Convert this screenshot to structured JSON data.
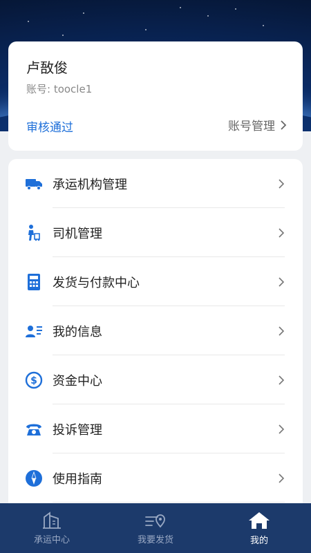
{
  "profile": {
    "name": "卢敔俊",
    "account": "账号: toocle1",
    "status": "审核通过",
    "manage_label": "账号管理"
  },
  "menu": {
    "items": [
      {
        "label": "承运机构管理",
        "icon": "truck-icon"
      },
      {
        "label": "司机管理",
        "icon": "driver-icon"
      },
      {
        "label": "发货与付款中心",
        "icon": "calculator-icon"
      },
      {
        "label": "我的信息",
        "icon": "id-card-icon"
      },
      {
        "label": "资金中心",
        "icon": "dollar-icon"
      },
      {
        "label": "投诉管理",
        "icon": "phone-icon"
      },
      {
        "label": "使用指南",
        "icon": "compass-icon"
      }
    ]
  },
  "tabbar": {
    "tabs": [
      {
        "label": "承运中心",
        "icon": "building-icon",
        "active": false
      },
      {
        "label": "我要发货",
        "icon": "delivery-icon",
        "active": false
      },
      {
        "label": "我的",
        "icon": "home-icon",
        "active": true
      }
    ]
  },
  "colors": {
    "accent": "#1e6fd9",
    "tabbar_bg": "#1c3a6b",
    "hero_bg": "#0a2a63"
  }
}
